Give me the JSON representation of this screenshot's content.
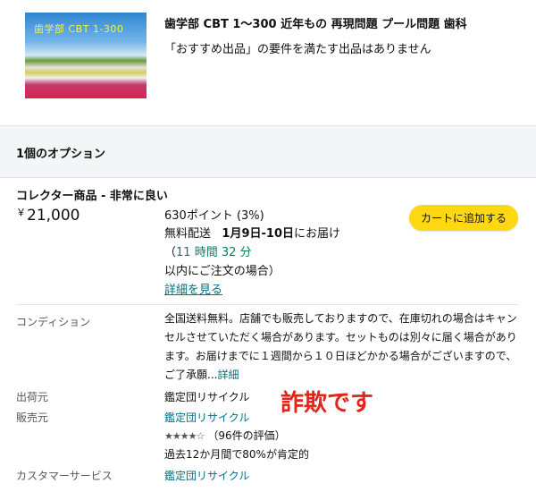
{
  "product": {
    "thumbnail_text": "歯学部 CBT 1-300",
    "title": "歯学部 CBT 1～300 近年もの 再現問題 プール問題 歯科",
    "notice": "「おすすめ出品」の要件を満たす出品はありません"
  },
  "options_header": "1個のオプション",
  "offer": {
    "condition_title": "コレクター商品 - 非常に良い",
    "currency_symbol": "￥",
    "price": "21,000",
    "points": "630ポイント (3%)",
    "delivery_prefix": "無料配送",
    "delivery_date": "1月9日-10日",
    "delivery_suffix": "にお届け",
    "order_within_open": "（",
    "order_within": "11 時間 32 分",
    "order_within_suffix": "以内にご注文の場合）",
    "details_link": "詳細を見る",
    "add_to_cart": "カートに追加する"
  },
  "info": {
    "condition_label": "コンディション",
    "condition_text": "全国送料無料。店舗でも販売しておりますので、在庫切れの場合はキャンセルさせていただく場合があります。セットものは別々に届く場合があります。お届けまでに１週間から１０日ほどかかる場合がございますので、ご了承願...",
    "condition_more": "詳細",
    "ships_from_label": "出荷元",
    "ships_from": "鑑定団リサイクル",
    "seller_label": "販売元",
    "seller": "鑑定団リサイクル",
    "seller_rating": 4,
    "rating_stars": "★★★★☆",
    "rating_count": "（96件の評価）",
    "positive": "過去12か月間で80%が肯定的",
    "customer_service_label": "カスタマーサービス",
    "customer_service": "鑑定団リサイクル"
  },
  "annotation": "詐欺です",
  "colors": {
    "button": "#ffd814",
    "link": "#007185",
    "countdown": "#067d62",
    "annotation": "#e3241a"
  }
}
